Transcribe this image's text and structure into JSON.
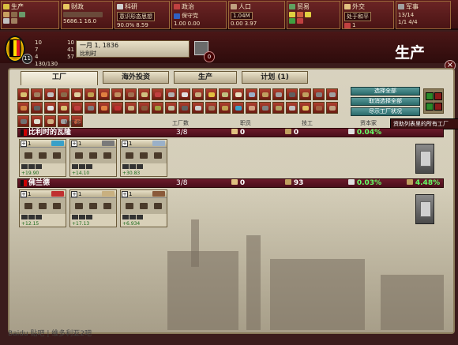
{
  "topbar": {
    "production": {
      "label": "生产",
      "rows": [
        "",
        "",
        ""
      ]
    },
    "finance": {
      "label": "财政",
      "line": "5686.1",
      "line2": "16.0"
    },
    "tech": {
      "label": "科研",
      "line": "意识形态思想",
      "pct": "90.0%",
      "val": "8.59"
    },
    "politics": {
      "label": "政治",
      "line": "保守党",
      "pct1": "1.00",
      "pct2": "0.00"
    },
    "population": {
      "label": "人口",
      "line": "1.04M",
      "v1": "0.00",
      "v2": "3.97"
    },
    "trade": {
      "label": "贸易"
    },
    "diplomacy": {
      "label": "外交",
      "line": "处于和平",
      "v": "1"
    },
    "military": {
      "label": "军事",
      "line": "13/14",
      "v2": "1/1",
      "v3": "4/4"
    }
  },
  "nation": {
    "rank": "11",
    "stats": [
      [
        "10",
        "10"
      ],
      [
        "7",
        "41"
      ],
      [
        "4",
        "57"
      ],
      [
        "130/130",
        ""
      ]
    ]
  },
  "date": {
    "main": "一月 1, 1836",
    "sub": "比利时"
  },
  "messages": {
    "count": "0"
  },
  "page_title": "生产",
  "close_label": "×",
  "tabs": [
    {
      "label": "工厂",
      "active": true
    },
    {
      "label": "海外投资",
      "active": false
    },
    {
      "label": "生产",
      "active": false
    },
    {
      "label": "计划 (1)",
      "active": false
    }
  ],
  "select_buttons": [
    "选择全部",
    "取消选择全部",
    "尽示工厂状况"
  ],
  "tooltip": "资助列表里的所有工厂",
  "columns": {
    "region": "地区名",
    "factories": "工厂数",
    "clerks": "职员",
    "workers": "技工",
    "capitalists": "资本家"
  },
  "states": [
    {
      "name": "比利时的瓦隆",
      "factories": "3/8",
      "clerks": "0",
      "workers": "0",
      "capital": "0.04%",
      "cards": [
        {
          "count": "1",
          "profit": "+19.90",
          "good": "#3aa0c8"
        },
        {
          "count": "1",
          "profit": "+14.10",
          "good": "#7a7a7a"
        },
        {
          "count": "1",
          "profit": "+30.83",
          "good": "#9ab0c8"
        }
      ]
    },
    {
      "name": "佛兰德",
      "factories": "3/8",
      "clerks": "0",
      "workers": "93",
      "capital": "0.03%",
      "extra": "4.48%",
      "cards": [
        {
          "count": "1",
          "profit": "+12.15",
          "good": "#c03030"
        },
        {
          "count": "1",
          "profit": "+17.13",
          "good": "#c8b080"
        },
        {
          "count": "1",
          "profit": "+6.934",
          "good": "#8a5a3a"
        }
      ]
    }
  ],
  "footer": "Baidu 贴吧 | 维多利亚2吧"
}
